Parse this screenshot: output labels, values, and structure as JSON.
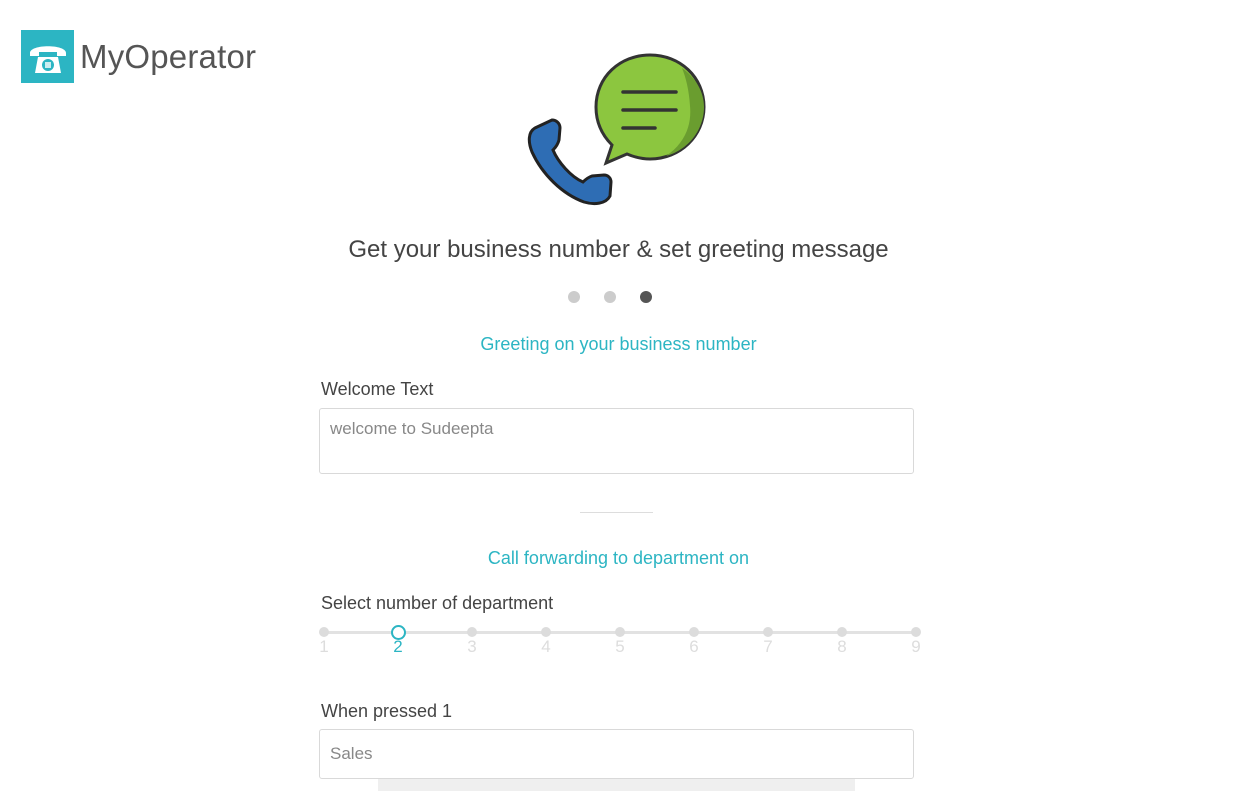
{
  "brand": {
    "name": "MyOperator",
    "accent_color": "#2cb5c3"
  },
  "hero": {
    "icons": [
      "phone-handset-icon",
      "chat-bubble-icon"
    ]
  },
  "header": {
    "title": "Get your business number & set greeting message"
  },
  "steps": {
    "total": 3,
    "active_index": 3
  },
  "greeting": {
    "heading": "Greeting on your business number",
    "welcome_label": "Welcome Text",
    "welcome_value": "welcome to Sudeepta"
  },
  "forwarding": {
    "heading": "Call forwarding to department on",
    "select_label": "Select number of department",
    "options": [
      "1",
      "2",
      "3",
      "4",
      "5",
      "6",
      "7",
      "8",
      "9"
    ],
    "selected": "2",
    "pressed_label": "When pressed 1",
    "pressed_value": "Sales"
  }
}
